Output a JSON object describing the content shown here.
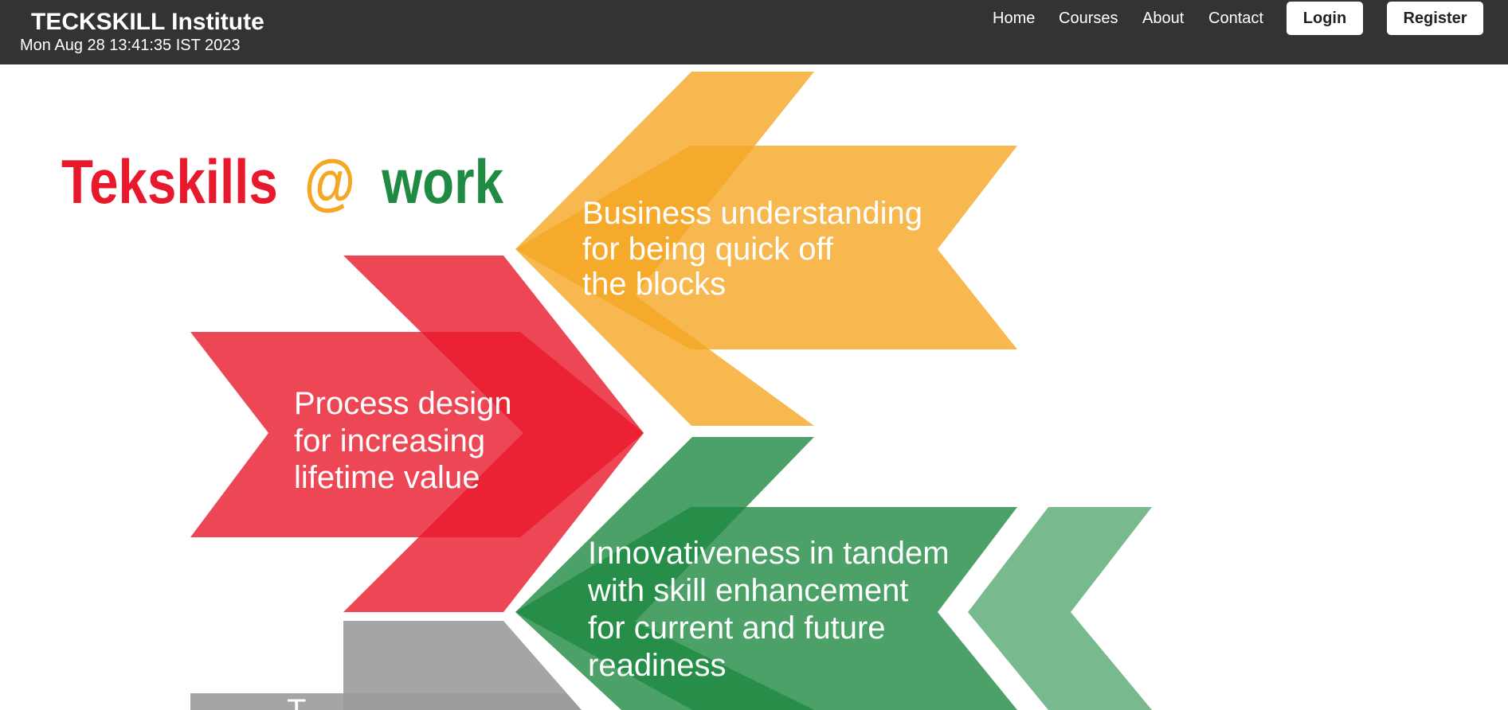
{
  "header": {
    "brand": "TECKSKILL Institute",
    "datetime": "Mon Aug 28 13:41:35 IST 2023",
    "nav": {
      "home": "Home",
      "courses": "Courses",
      "about": "About",
      "contact": "Contact"
    },
    "login_label": "Login",
    "register_label": "Register"
  },
  "hero": {
    "logo": {
      "part1": "Tekskills",
      "part2": "@",
      "part3": "work"
    },
    "arrows": {
      "business": {
        "line1": "Business understanding",
        "line2": "for being quick off",
        "line3": "the blocks"
      },
      "process": {
        "line1": "Process design",
        "line2": "for increasing",
        "line3": "lifetime value"
      },
      "innovation": {
        "line1": "Innovativeness in tandem",
        "line2": "with skill enhancement",
        "line3": "for current and future",
        "line4": "readiness"
      },
      "gray": {
        "line1": "T"
      }
    }
  },
  "colors": {
    "header_bg": "#333333",
    "orange": "#F5A623",
    "red": "#E8192C",
    "green": "#1E8A42",
    "gray": "#9A9B9D"
  }
}
